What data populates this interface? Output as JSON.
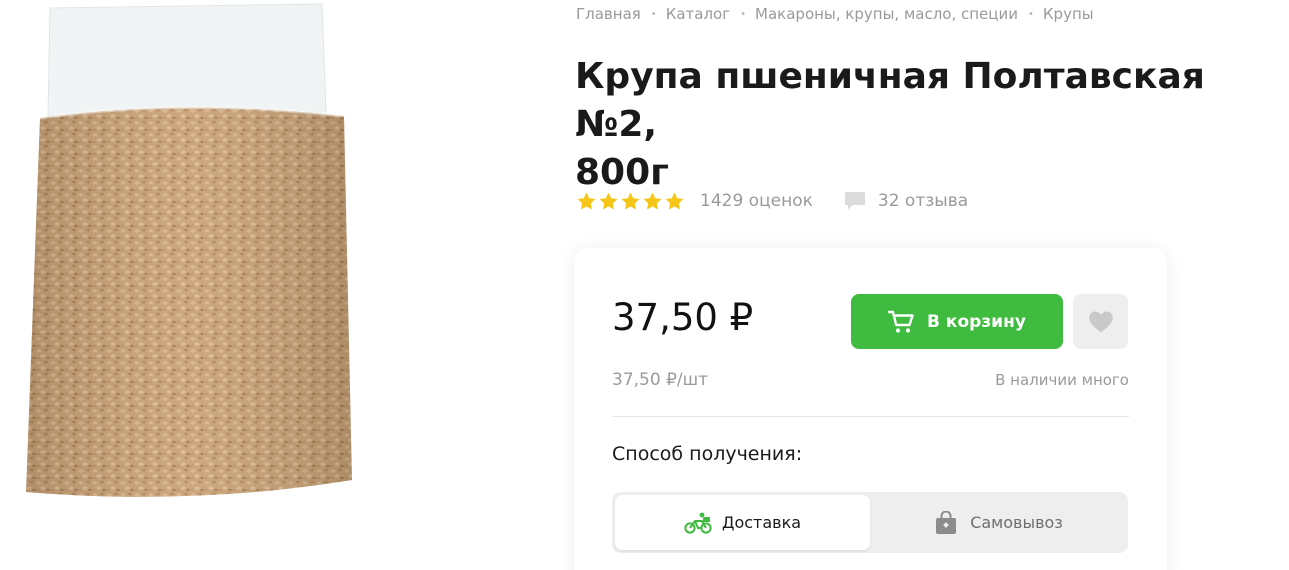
{
  "breadcrumb": [
    "Главная",
    "Каталог",
    "Макароны, крупы, масло, специи",
    "Крупы"
  ],
  "product": {
    "title_line1": "Крупа пшеничная Полтавская №2,",
    "title_line2": "800г"
  },
  "rating": {
    "stars": 5,
    "ratings_count_text": "1429 оценок",
    "reviews_text": "32 отзыва"
  },
  "offer": {
    "price": "37,50 ₽",
    "unit_price": "37,50 ₽/шт",
    "stock": "В наличии много",
    "add_to_cart_label": "В корзину",
    "receive_title": "Способ получения:",
    "receive_options": [
      {
        "label": "Доставка",
        "icon": "bicycle-courier-icon",
        "active": true
      },
      {
        "label": "Самовывоз",
        "icon": "pickup-bag-icon",
        "active": false
      }
    ]
  },
  "colors": {
    "accent_green": "#3fbb3f",
    "star_yellow": "#f5c518",
    "muted_text": "#9a9a9a"
  }
}
